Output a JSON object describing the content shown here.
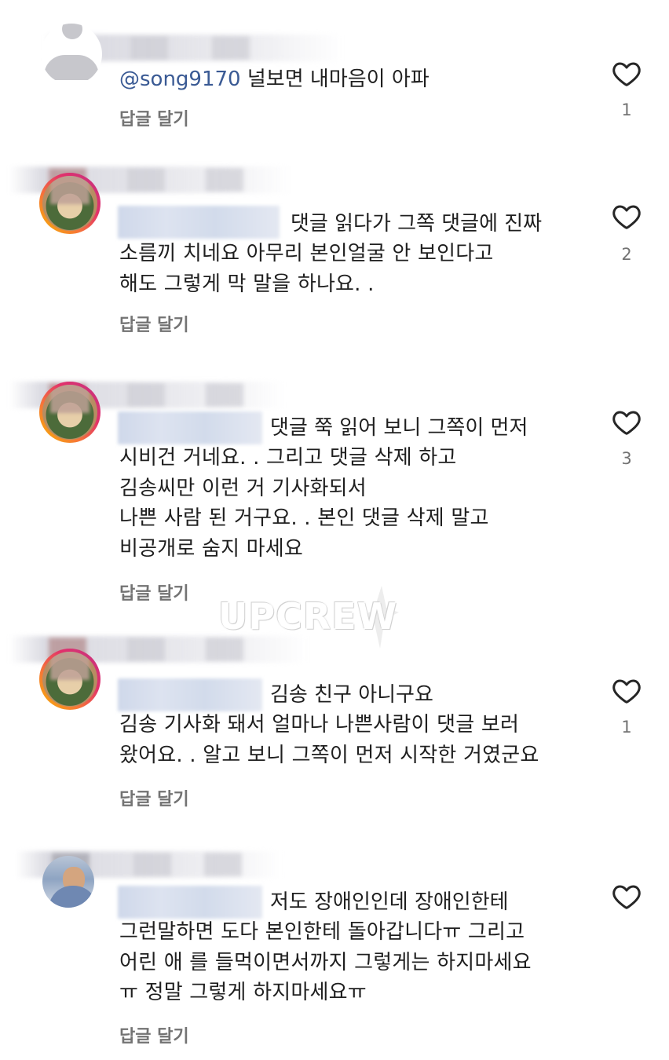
{
  "comments": [
    {
      "mention": "@song9170",
      "text": "널보면 내마음이 아파",
      "reply_label": "답글 달기",
      "likes": "1"
    },
    {
      "first_line": "댓글 읽다가 그쪽 댓글에 진짜",
      "body": "소름끼 치네요 아무리 본인얼굴 안 보인다고\n해도 그렇게 막 말을 하나요. .",
      "reply_label": "답글 달기",
      "likes": "2"
    },
    {
      "first_line": "댓글 쭉 읽어 보니 그쪽이 먼저",
      "body": "시비건 거네요. . 그리고 댓글 삭제 하고\n김송씨만 이런 거 기사화되서\n나쁜 사람 된 거구요. . 본인 댓글 삭제 말고\n비공개로 숨지 마세요",
      "reply_label": "답글 달기",
      "likes": "3"
    },
    {
      "first_line": "김송 친구 아니구요",
      "body": "김송 기사화 돼서 얼마나 나쁜사람이 댓글 보러\n왔어요. . 알고 보니 그쪽이 먼저 시작한 거였군요",
      "reply_label": "답글 달기",
      "likes": "1"
    },
    {
      "first_line": "저도 장애인인데 장애인한테",
      "body": "그런말하면 도다 본인한테 돌아갑니다ㅠ 그리고\n어린 애 를 들먹이면서까지 그렇게는 하지마세요\nㅠ 정말 그렇게 하지마세요ㅠ",
      "reply_label": "답글 달기",
      "likes": ""
    }
  ],
  "watermark": "UPCREW",
  "icons": {
    "like": "heart-outline-icon"
  },
  "colors": {
    "text": "#262626",
    "secondary": "#737373",
    "mention": "#3a5a94"
  }
}
